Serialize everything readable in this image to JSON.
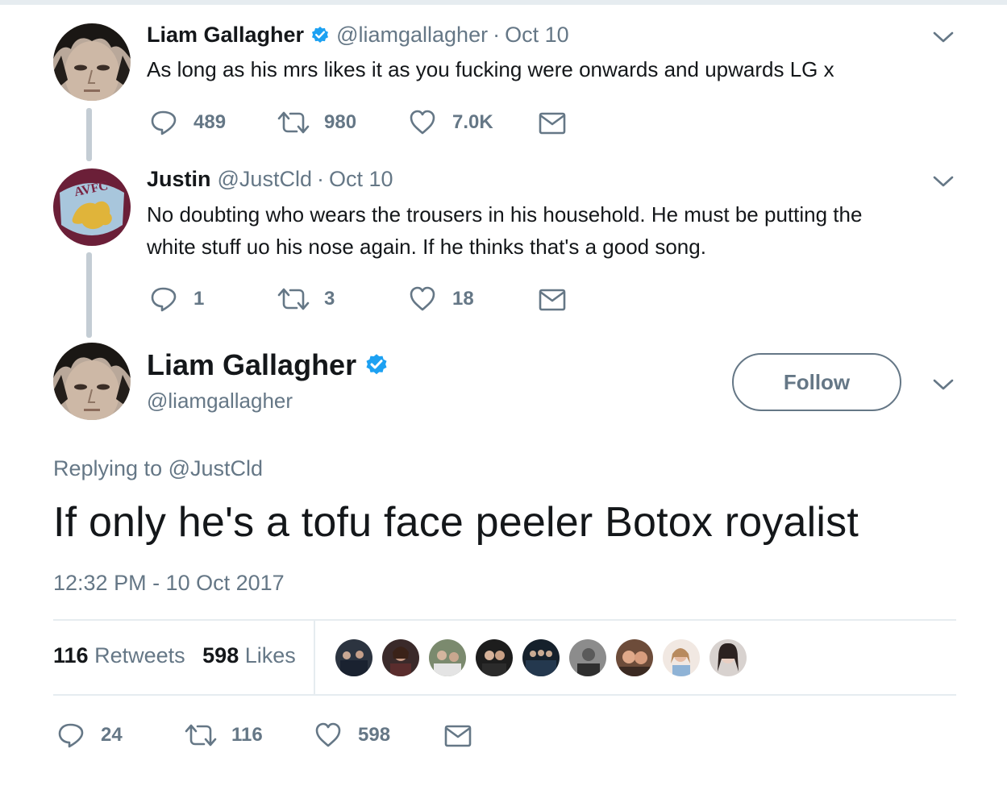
{
  "thread": [
    {
      "name": "Liam Gallagher",
      "verified": true,
      "handle": "@liamgallagher",
      "separator": "·",
      "date": "Oct 10",
      "text": "As long as his mrs likes it as you fucking were onwards and upwards LG x",
      "replies": "489",
      "retweets": "980",
      "likes": "7.0K"
    },
    {
      "name": "Justin",
      "verified": false,
      "handle": "@JustCld",
      "separator": "·",
      "date": "Oct 10",
      "text_line1": "No doubting who wears the trousers in his household. He must be putting the",
      "text_line2": "white stuff uo his nose again. If he thinks that's  a good song.",
      "avatar_text": "AVFC",
      "replies": "1",
      "retweets": "3",
      "likes": "18"
    }
  ],
  "main_tweet": {
    "name": "Liam Gallagher",
    "verified": true,
    "handle": "@liamgallagher",
    "follow_label": "Follow",
    "replying_prefix": "Replying to",
    "replying_to": "@JustCld",
    "text": "If only he's a tofu face peeler Botox royalist",
    "timestamp": "12:32 PM - 10 Oct 2017",
    "retweet_count": "116",
    "retweet_label": "Retweets",
    "like_count": "598",
    "like_label": "Likes",
    "replies": "24",
    "retweets": "116",
    "likes": "598"
  },
  "colors": {
    "text_primary": "#14171a",
    "text_secondary": "#657786",
    "verified_blue": "#1da1f2",
    "border": "#e6ecf0",
    "thread_line": "#c4cdd4"
  },
  "icons": [
    "reply-icon",
    "retweet-icon",
    "like-icon",
    "direct-message-icon",
    "chevron-down-icon",
    "verified-badge-icon"
  ]
}
